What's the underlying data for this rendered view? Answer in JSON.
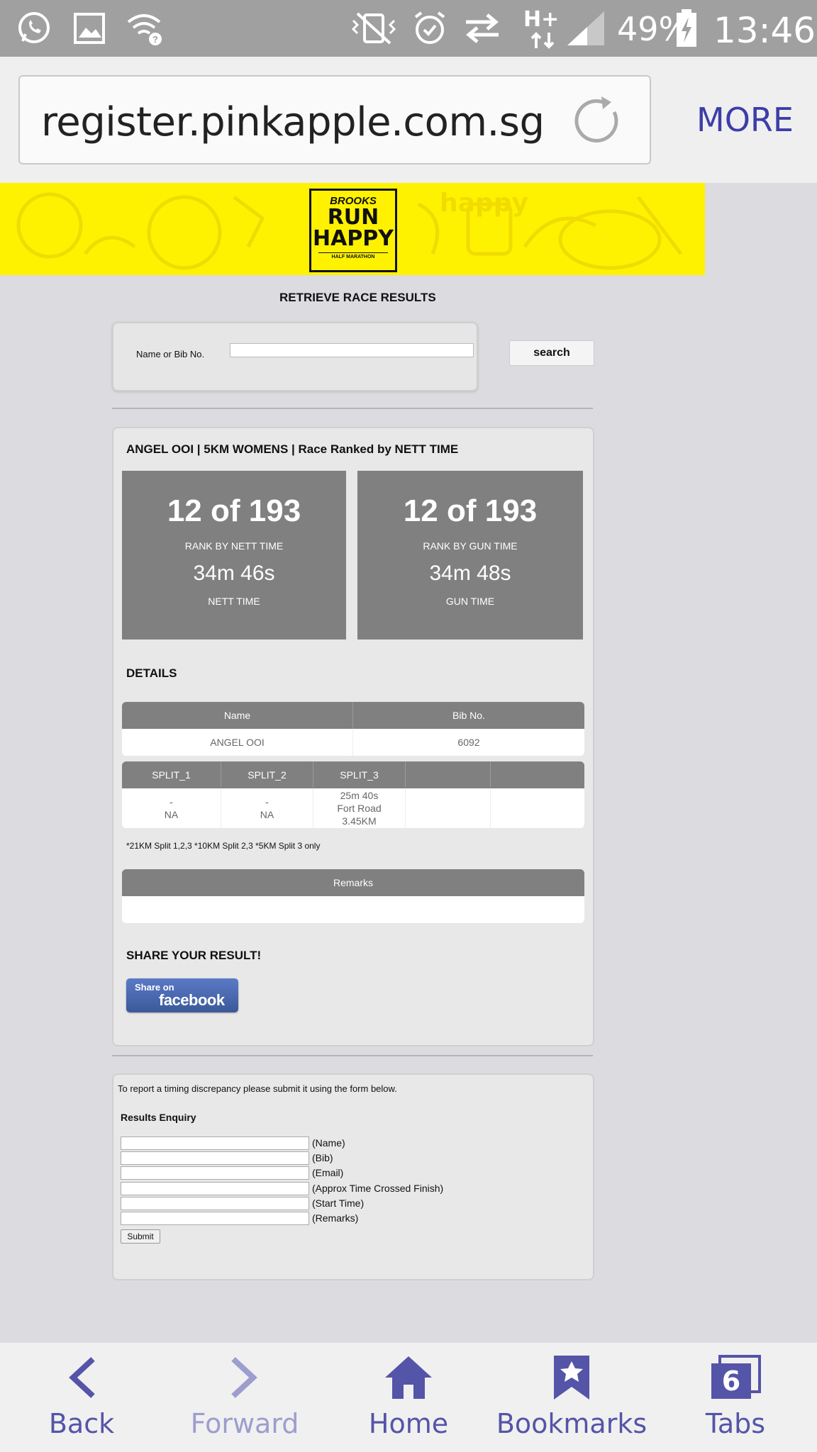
{
  "status_bar": {
    "battery": "49%",
    "time": "13:46",
    "network": "H+"
  },
  "browser": {
    "url": "register.pinkapple.com.sg",
    "more_label": "MORE"
  },
  "banner": {
    "brand": "BROOKS",
    "logo_line1": "RUN",
    "logo_line2": "HAPPY",
    "logo_sub": "HALF MARATHON",
    "bg_color": "#fff200"
  },
  "page": {
    "title": "RETRIEVE RACE RESULTS",
    "search_label": "Name or Bib No.",
    "search_placeholder": "",
    "search_button": "search"
  },
  "result": {
    "heading": "ANGEL OOI | 5KM WOMENS | Race Ranked by NETT TIME",
    "nett": {
      "rank": "12 of 193",
      "rank_label": "RANK BY NETT TIME",
      "time": "34m 46s",
      "time_label": "NETT TIME"
    },
    "gun": {
      "rank": "12 of 193",
      "rank_label": "RANK BY GUN TIME",
      "time": "34m 48s",
      "time_label": "GUN TIME"
    },
    "details_heading": "DETAILS",
    "details_table": {
      "headers": [
        "Name",
        "Bib No."
      ],
      "row": [
        "ANGEL OOI",
        "6092"
      ]
    },
    "splits_table": {
      "headers": [
        "SPLIT_1",
        "SPLIT_2",
        "SPLIT_3",
        "",
        ""
      ],
      "split1": {
        "line1": "-",
        "line2": "NA"
      },
      "split2": {
        "line1": "-",
        "line2": "NA"
      },
      "split3": {
        "line1": "25m 40s",
        "line2": "Fort Road",
        "line3": "3.45KM"
      }
    },
    "split_note": "*21KM Split 1,2,3 *10KM Split 2,3 *5KM Split 3 only",
    "remarks_header": "Remarks",
    "remarks_value": "",
    "share_heading": "SHARE YOUR RESULT!",
    "facebook_small": "Share on",
    "facebook_big": "facebook"
  },
  "enquiry": {
    "note": "To report a timing discrepancy please submit it using the form below.",
    "title": "Results Enquiry",
    "fields": [
      "(Name)",
      "(Bib)",
      "(Email)",
      "(Approx Time Crossed Finish)",
      "(Start Time)",
      "(Remarks)"
    ],
    "submit_label": "Submit"
  },
  "bottom_nav": {
    "back": "Back",
    "forward": "Forward",
    "home": "Home",
    "bookmarks": "Bookmarks",
    "tabs": "Tabs",
    "tab_count": "6"
  }
}
